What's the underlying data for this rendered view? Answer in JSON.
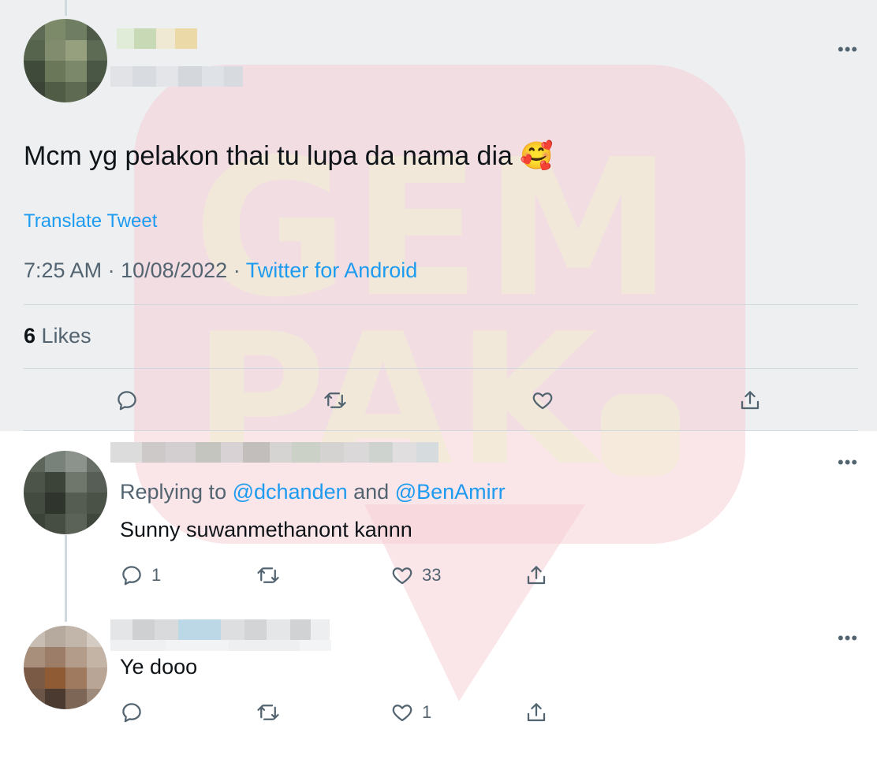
{
  "tweet": {
    "text": "Mcm yg pelakon thai tu lupa da nama dia",
    "emoji": "🥰",
    "translate_label": "Translate Tweet",
    "time": "7:25 AM",
    "separator": " · ",
    "date": "10/08/2022",
    "source": "Twitter for Android",
    "likes_count": "6",
    "likes_label": " Likes",
    "more_label": "•••"
  },
  "watermark": {
    "line1": "GEM",
    "line2": "PAK"
  },
  "replies": [
    {
      "replying_prefix": "Replying to ",
      "mention1": "@dchanden",
      "conj": " and ",
      "mention2": "@BenAmirr",
      "text": "Sunny suwanmethanont kannn",
      "reply_count": "1",
      "like_count": "33"
    },
    {
      "text": "Ye dooo",
      "like_count": "1"
    }
  ],
  "colors": {
    "accent": "#1d9bf0",
    "muted": "#536471",
    "divider": "#cfd9de",
    "top_bg": "#eeeff1"
  }
}
